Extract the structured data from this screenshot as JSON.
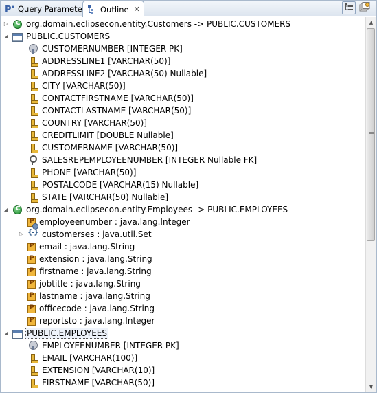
{
  "tabs": {
    "query_parameters": "Query Parameters",
    "outline": "Outline"
  },
  "toolbar": {
    "buttons": [
      {
        "icon": "tree-layout-icon",
        "active": true
      },
      {
        "icon": "view-options-icon",
        "active": false
      }
    ]
  },
  "tree": [
    {
      "label": "org.domain.eclipsecon.entity.Customers -> PUBLIC.CUSTOMERS",
      "icon": "class-icon",
      "twisty": "collapsed",
      "depth": 0
    },
    {
      "label": "PUBLIC.CUSTOMERS",
      "icon": "table-icon",
      "twisty": "expanded",
      "depth": 0
    },
    {
      "label": "CUSTOMERNUMBER [INTEGER PK]",
      "icon": "primary-key-column-icon",
      "twisty": "none",
      "depth": 1
    },
    {
      "label": "ADDRESSLINE1 [VARCHAR(50)]",
      "icon": "column-icon",
      "twisty": "none",
      "depth": 1
    },
    {
      "label": "ADDRESSLINE2 [VARCHAR(50) Nullable]",
      "icon": "column-icon",
      "twisty": "none",
      "depth": 1
    },
    {
      "label": "CITY [VARCHAR(50)]",
      "icon": "column-icon",
      "twisty": "none",
      "depth": 1
    },
    {
      "label": "CONTACTFIRSTNAME [VARCHAR(50)]",
      "icon": "column-icon",
      "twisty": "none",
      "depth": 1
    },
    {
      "label": "CONTACTLASTNAME [VARCHAR(50)]",
      "icon": "column-icon",
      "twisty": "none",
      "depth": 1
    },
    {
      "label": "COUNTRY [VARCHAR(50)]",
      "icon": "column-icon",
      "twisty": "none",
      "depth": 1
    },
    {
      "label": "CREDITLIMIT [DOUBLE Nullable]",
      "icon": "column-icon",
      "twisty": "none",
      "depth": 1
    },
    {
      "label": "CUSTOMERNAME [VARCHAR(50)]",
      "icon": "column-icon",
      "twisty": "none",
      "depth": 1
    },
    {
      "label": "SALESREPEMPLOYEENUMBER [INTEGER Nullable FK]",
      "icon": "foreign-key-column-icon",
      "twisty": "none",
      "depth": 1
    },
    {
      "label": "PHONE [VARCHAR(50)]",
      "icon": "column-icon",
      "twisty": "none",
      "depth": 1
    },
    {
      "label": "POSTALCODE [VARCHAR(15) Nullable]",
      "icon": "column-icon",
      "twisty": "none",
      "depth": 1
    },
    {
      "label": "STATE [VARCHAR(50) Nullable]",
      "icon": "column-icon",
      "twisty": "none",
      "depth": 1
    },
    {
      "label": "org.domain.eclipsecon.entity.Employees -> PUBLIC.EMPLOYEES",
      "icon": "class-icon",
      "twisty": "expanded",
      "depth": 0
    },
    {
      "label": "employeenumber : java.lang.Integer",
      "icon": "id-property-icon",
      "twisty": "none",
      "depth": 1
    },
    {
      "label": "customerses : java.util.Set",
      "icon": "collection-icon",
      "twisty": "collapsed",
      "depth": 1
    },
    {
      "label": "email : java.lang.String",
      "icon": "property-icon",
      "twisty": "none",
      "depth": 1
    },
    {
      "label": "extension : java.lang.String",
      "icon": "property-icon",
      "twisty": "none",
      "depth": 1
    },
    {
      "label": "firstname : java.lang.String",
      "icon": "property-icon",
      "twisty": "none",
      "depth": 1
    },
    {
      "label": "jobtitle : java.lang.String",
      "icon": "property-icon",
      "twisty": "none",
      "depth": 1
    },
    {
      "label": "lastname : java.lang.String",
      "icon": "property-icon",
      "twisty": "none",
      "depth": 1
    },
    {
      "label": "officecode : java.lang.String",
      "icon": "property-icon",
      "twisty": "none",
      "depth": 1
    },
    {
      "label": "reportsto : java.lang.Integer",
      "icon": "property-icon",
      "twisty": "none",
      "depth": 1
    },
    {
      "label": "PUBLIC.EMPLOYEES",
      "icon": "table-icon",
      "twisty": "expanded",
      "depth": 0,
      "selected": true
    },
    {
      "label": "EMPLOYEENUMBER [INTEGER PK]",
      "icon": "primary-key-column-icon",
      "twisty": "none",
      "depth": 1
    },
    {
      "label": "EMAIL [VARCHAR(100)]",
      "icon": "column-icon",
      "twisty": "none",
      "depth": 1
    },
    {
      "label": "EXTENSION [VARCHAR(10)]",
      "icon": "column-icon",
      "twisty": "none",
      "depth": 1
    },
    {
      "label": "FIRSTNAME [VARCHAR(50)]",
      "icon": "column-icon",
      "twisty": "none",
      "depth": 1
    }
  ]
}
